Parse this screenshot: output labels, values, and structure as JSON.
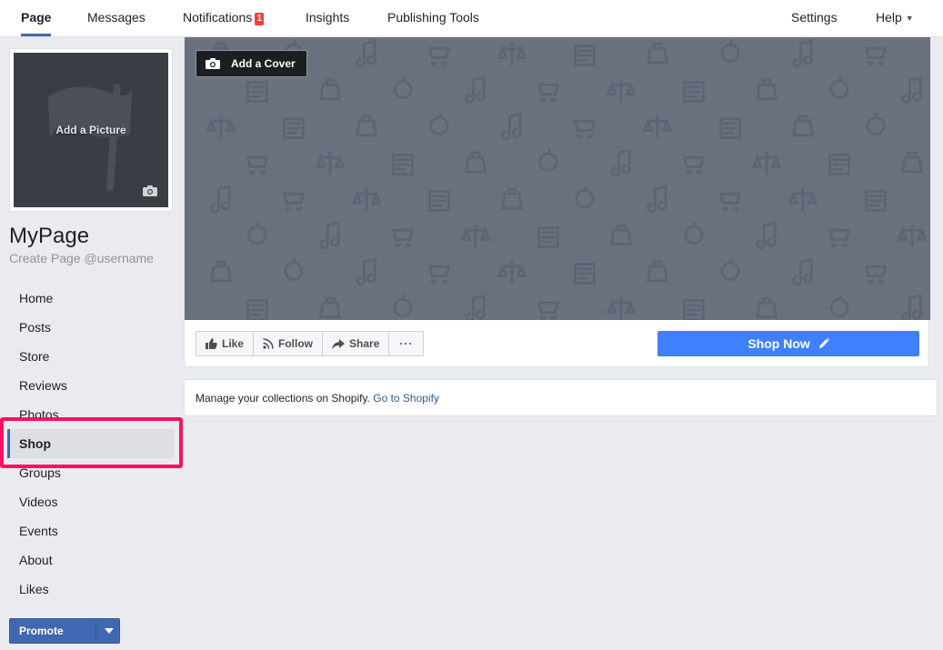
{
  "nav": {
    "left": [
      {
        "label": "Page",
        "active": true
      },
      {
        "label": "Messages"
      },
      {
        "label": "Notifications",
        "badge": "1"
      },
      {
        "label": "Insights"
      },
      {
        "label": "Publishing Tools"
      }
    ],
    "settings_label": "Settings",
    "help_label": "Help"
  },
  "profile": {
    "add_picture_label": "Add a Picture",
    "page_name": "MyPage",
    "username_hint": "Create Page @username"
  },
  "sidebar": {
    "items": [
      {
        "label": "Home"
      },
      {
        "label": "Posts"
      },
      {
        "label": "Store"
      },
      {
        "label": "Reviews"
      },
      {
        "label": "Photos"
      },
      {
        "label": "Shop",
        "active": true
      },
      {
        "label": "Groups"
      },
      {
        "label": "Videos"
      },
      {
        "label": "Events"
      },
      {
        "label": "About"
      },
      {
        "label": "Likes"
      }
    ],
    "promote_label": "Promote"
  },
  "cover": {
    "add_cover_label": "Add a Cover"
  },
  "actions": {
    "like_label": "Like",
    "follow_label": "Follow",
    "share_label": "Share",
    "more_label": "···",
    "shop_now_label": "Shop Now"
  },
  "info": {
    "text": "Manage your collections on Shopify.",
    "link_label": "Go to Shopify"
  },
  "colors": {
    "brand": "#4267b2",
    "shop_now": "#4080ff",
    "highlight": "#ff1061",
    "badge": "#fa3e3e",
    "cover": "#6a717f"
  }
}
